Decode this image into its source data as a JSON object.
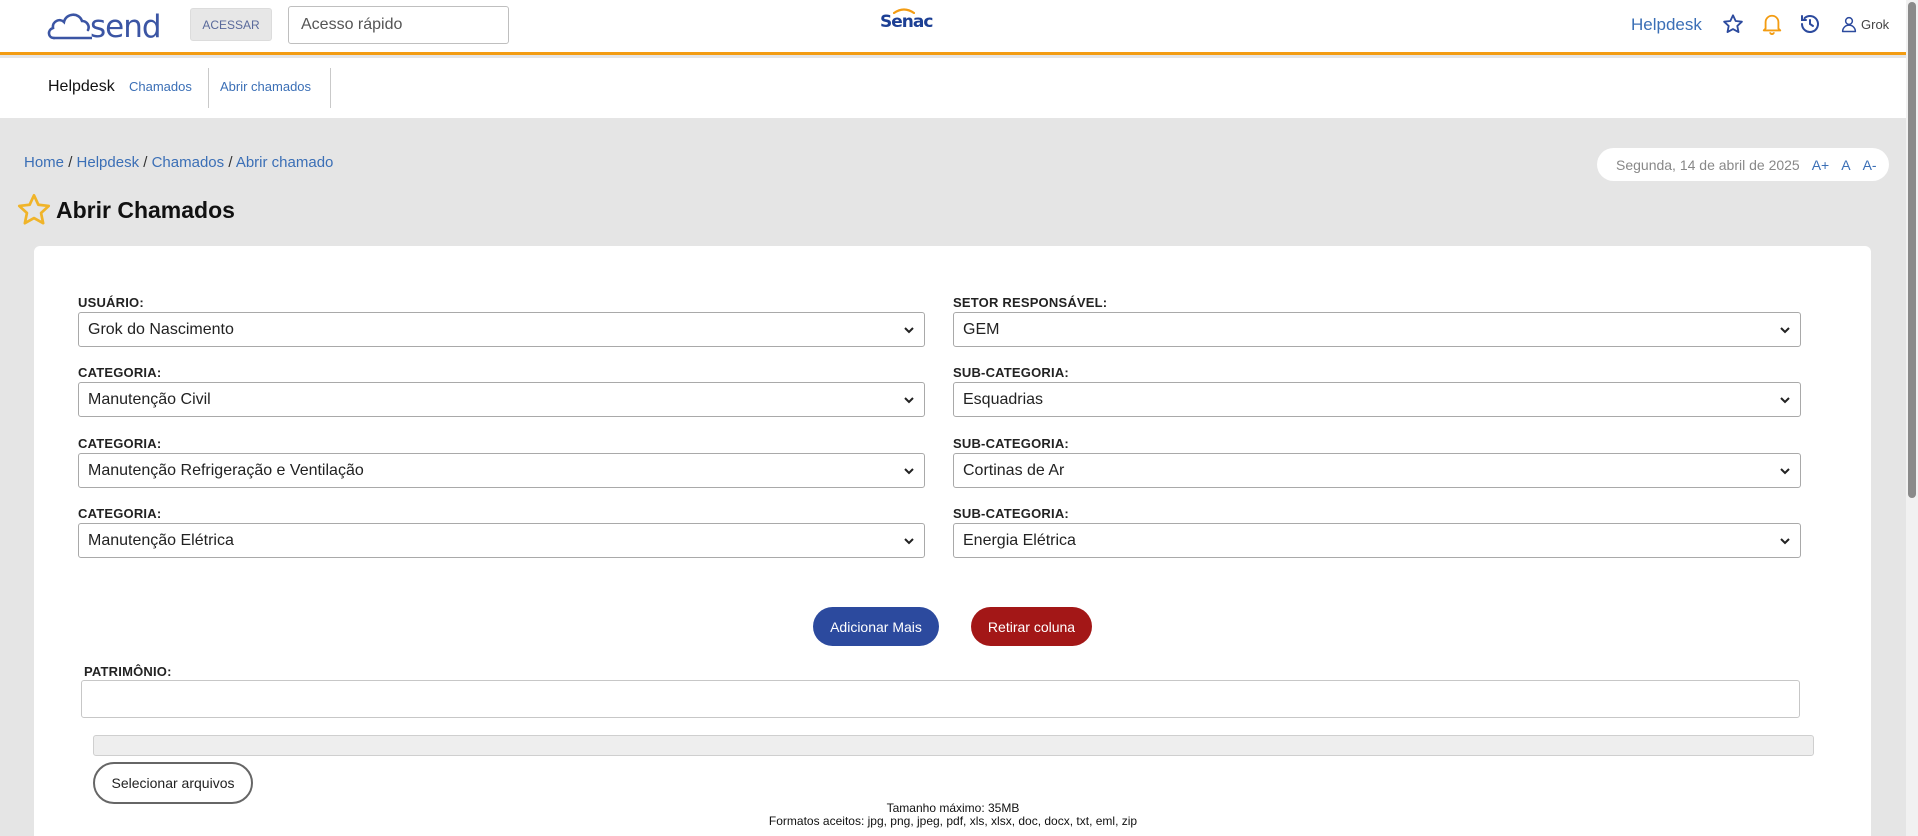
{
  "header": {
    "logo_text": "send",
    "login_button": "ACESSAR",
    "quick_access_placeholder": "Acesso rápido",
    "brand": "Senac",
    "helpdesk_link": "Helpdesk",
    "user_name": "Grok",
    "icons": [
      "favorites-star-icon",
      "notification-bell-icon",
      "history-clock-icon",
      "user-icon"
    ],
    "accent_color": "#f39c12"
  },
  "subnav": {
    "title": "Helpdesk",
    "tabs": [
      {
        "label": "Chamados"
      },
      {
        "label": "Abrir chamados"
      }
    ]
  },
  "breadcrumb": {
    "items": [
      "Home",
      "Helpdesk",
      "Chamados",
      "Abrir chamado"
    ],
    "separator": "/"
  },
  "date_bar": {
    "date": "Segunda, 14 de abril de 2025",
    "font_increase": "A+",
    "font_reset": "A",
    "font_decrease": "A-"
  },
  "page_title": "Abrir Chamados",
  "form": {
    "usuario": {
      "label": "USUÁRIO:",
      "value": "Grok do Nascimento"
    },
    "setor": {
      "label": "SETOR RESPONSÁVEL:",
      "value": "GEM"
    },
    "rows": [
      {
        "category_label": "CATEGORIA:",
        "category_value": "Manutenção Civil",
        "sub_label": "SUB-CATEGORIA:",
        "sub_value": "Esquadrias"
      },
      {
        "category_label": "CATEGORIA:",
        "category_value": "Manutenção Refrigeração e Ventilação",
        "sub_label": "SUB-CATEGORIA:",
        "sub_value": "Cortinas de Ar"
      },
      {
        "category_label": "CATEGORIA:",
        "category_value": "Manutenção Elétrica",
        "sub_label": "SUB-CATEGORIA:",
        "sub_value": "Energia Elétrica"
      }
    ],
    "add_button": "Adicionar Mais",
    "remove_button": "Retirar coluna",
    "patrimonio_label": "PATRIMÔNIO:",
    "patrimonio_value": "",
    "upload_progress": 0,
    "select_files_button": "Selecionar arquivos",
    "max_size": "Tamanho máximo: 35MB",
    "formats": "Formatos aceitos: jpg, png, jpeg, pdf, xls, xlsx, doc, docx, txt, eml, zip"
  },
  "colors": {
    "primary_button": "#2c4a9e",
    "danger_button": "#a31717",
    "link": "#3b6fb6"
  }
}
